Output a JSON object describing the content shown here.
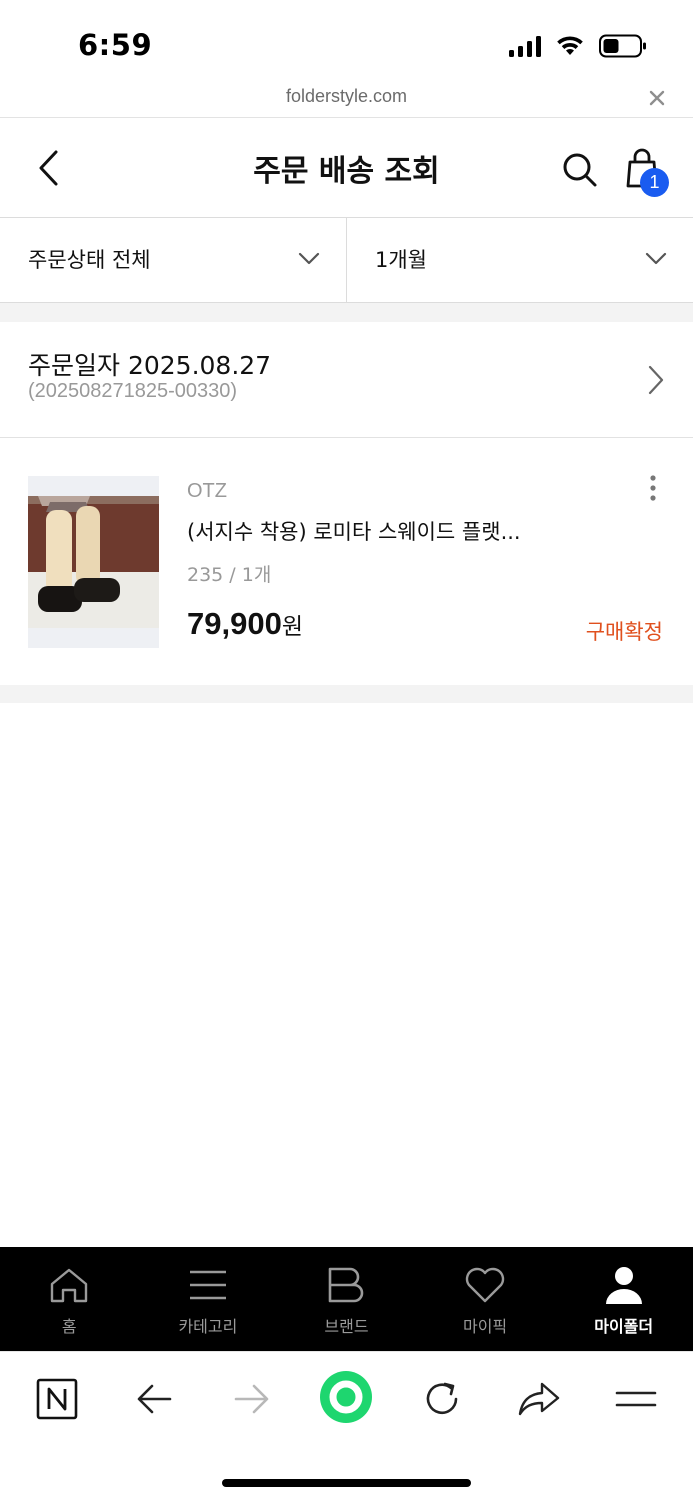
{
  "status_bar": {
    "time": "6:59"
  },
  "browser": {
    "url": "folderstyle.com"
  },
  "header": {
    "title": "주문 배송 조회",
    "cart_count": "1"
  },
  "filters": [
    {
      "label": "주문상태 전체"
    },
    {
      "label": "1개월"
    }
  ],
  "order": {
    "date_label": "주문일자 2025.08.27",
    "order_number": "(202508271825-00330)",
    "items": [
      {
        "brand": "OTZ",
        "name": "(서지수 착용) 로미타 스웨이드 플랫...",
        "option": "235 / 1개",
        "price": "79,900",
        "price_unit": "원",
        "status": "구매확정"
      }
    ]
  },
  "bottom_nav": {
    "items": [
      {
        "label": "홈",
        "icon": "home-icon"
      },
      {
        "label": "카테고리",
        "icon": "menu-lines-icon"
      },
      {
        "label": "브랜드",
        "icon": "brand-b-icon"
      },
      {
        "label": "마이픽",
        "icon": "heart-icon"
      },
      {
        "label": "마이폴더",
        "icon": "person-icon",
        "active": true
      }
    ]
  },
  "colors": {
    "accent_status": "#e0501e",
    "badge_blue": "#1a5cf0",
    "browser_green": "#1ed66f"
  }
}
